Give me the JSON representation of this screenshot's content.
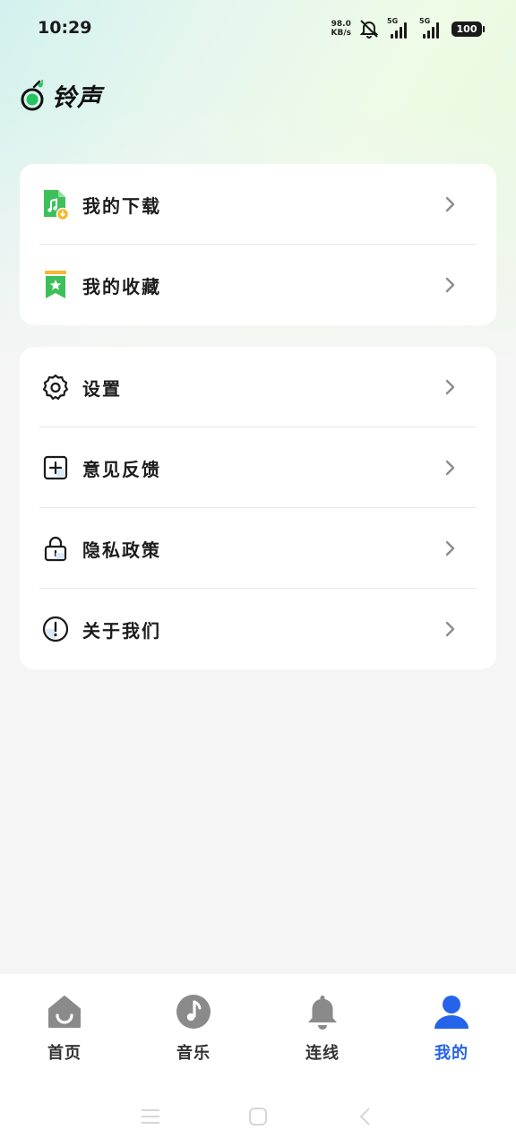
{
  "status_bar": {
    "time": "10:29",
    "net_speed_value": "98.0",
    "net_speed_unit": "KB/s",
    "sim1_tag": "5G",
    "sim2_tag": "5G",
    "battery": "100"
  },
  "header": {
    "app_title": "铃声",
    "logo_color": "#22c55e"
  },
  "menu_group_1": {
    "items": [
      {
        "label": "我的下载",
        "icon": "music-file-download-icon"
      },
      {
        "label": "我的收藏",
        "icon": "bookmark-star-icon"
      }
    ]
  },
  "menu_group_2": {
    "items": [
      {
        "label": "设置",
        "icon": "gear-icon"
      },
      {
        "label": "意见反馈",
        "icon": "plus-square-icon"
      },
      {
        "label": "隐私政策",
        "icon": "lock-icon"
      },
      {
        "label": "关于我们",
        "icon": "info-circle-icon"
      }
    ]
  },
  "tabbar": {
    "tabs": [
      {
        "label": "首页",
        "icon": "home-icon",
        "active": false
      },
      {
        "label": "音乐",
        "icon": "music-note-icon",
        "active": false
      },
      {
        "label": "连线",
        "icon": "bell-icon",
        "active": false
      },
      {
        "label": "我的",
        "icon": "user-icon",
        "active": true
      }
    ],
    "active_color": "#2563eb",
    "inactive_icon_color": "#8a8a8a"
  },
  "system_nav": {
    "buttons": [
      "menu-icon",
      "home-square-icon",
      "back-icon"
    ]
  }
}
